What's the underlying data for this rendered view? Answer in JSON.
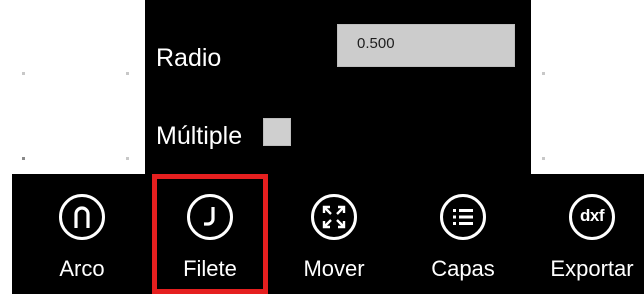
{
  "properties": {
    "radio_label": "Radio",
    "radio_value": "0.500",
    "multiple_label": "Múltiple",
    "multiple_checked": false
  },
  "appbar": {
    "selected": "Filete",
    "buttons": [
      {
        "label": "Arco",
        "icon": "arc-icon"
      },
      {
        "label": "Filete",
        "icon": "fillet-icon"
      },
      {
        "label": "Mover",
        "icon": "move-icon"
      },
      {
        "label": "Capas",
        "icon": "layers-icon"
      },
      {
        "label": "Exportar",
        "icon": "dxf-icon",
        "icon_text": "dxf"
      }
    ]
  },
  "colors": {
    "panel_bg": "#000000",
    "text": "#ffffff",
    "input_bg": "#cccccc",
    "selection_border": "#e51f1f"
  }
}
